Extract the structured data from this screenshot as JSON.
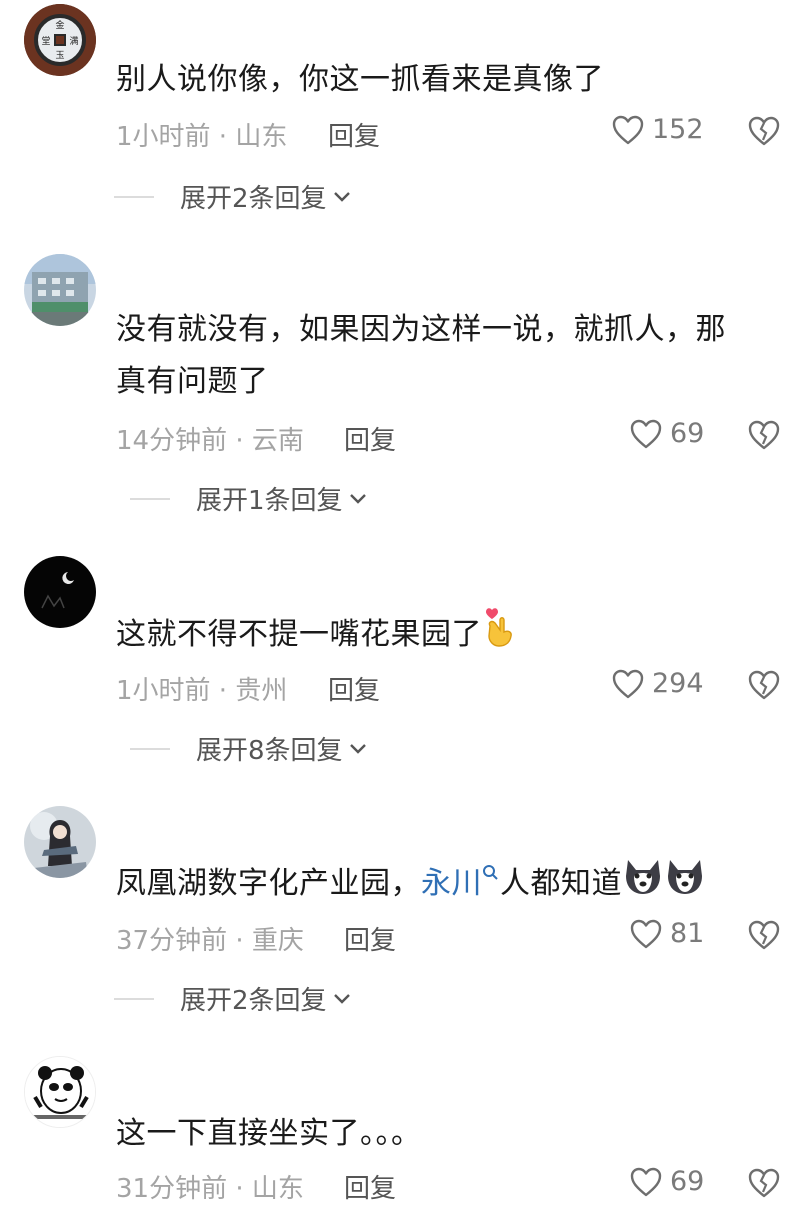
{
  "comments": [
    {
      "text": "别人说你像，你这一抓看来是真像了",
      "meta": "1小时前 · 山东",
      "reply_label": "回复",
      "likes": "152",
      "expand_label": "展开2条回复"
    },
    {
      "text_line1": "没有就没有，如果因为这样一说，就抓人，那",
      "text_line2": "真有问题了",
      "meta": "14分钟前 · 云南",
      "reply_label": "回复",
      "likes": "69",
      "expand_label": "展开1条回复"
    },
    {
      "text": "这就不得不提一嘴花果园了",
      "meta": "1小时前 · 贵州",
      "reply_label": "回复",
      "likes": "294",
      "expand_label": "展开8条回复"
    },
    {
      "text_before": "凤凰湖数字化产业园，",
      "link_text": "永川",
      "text_after": "人都知道",
      "meta": "37分钟前 · 重庆",
      "reply_label": "回复",
      "likes": "81",
      "expand_label": "展开2条回复"
    },
    {
      "text": "这一下直接坐实了。。。",
      "meta": "31分钟前 · 山东",
      "reply_label": "回复",
      "likes": "69"
    }
  ],
  "icons": {
    "like": "heart-outline-icon",
    "dislike": "broken-heart-icon",
    "expand": "chevron-down-icon",
    "search": "search-icon"
  },
  "colors": {
    "text": "#1a1a1a",
    "meta": "#a4a4a4",
    "link": "#2f6fb5"
  }
}
